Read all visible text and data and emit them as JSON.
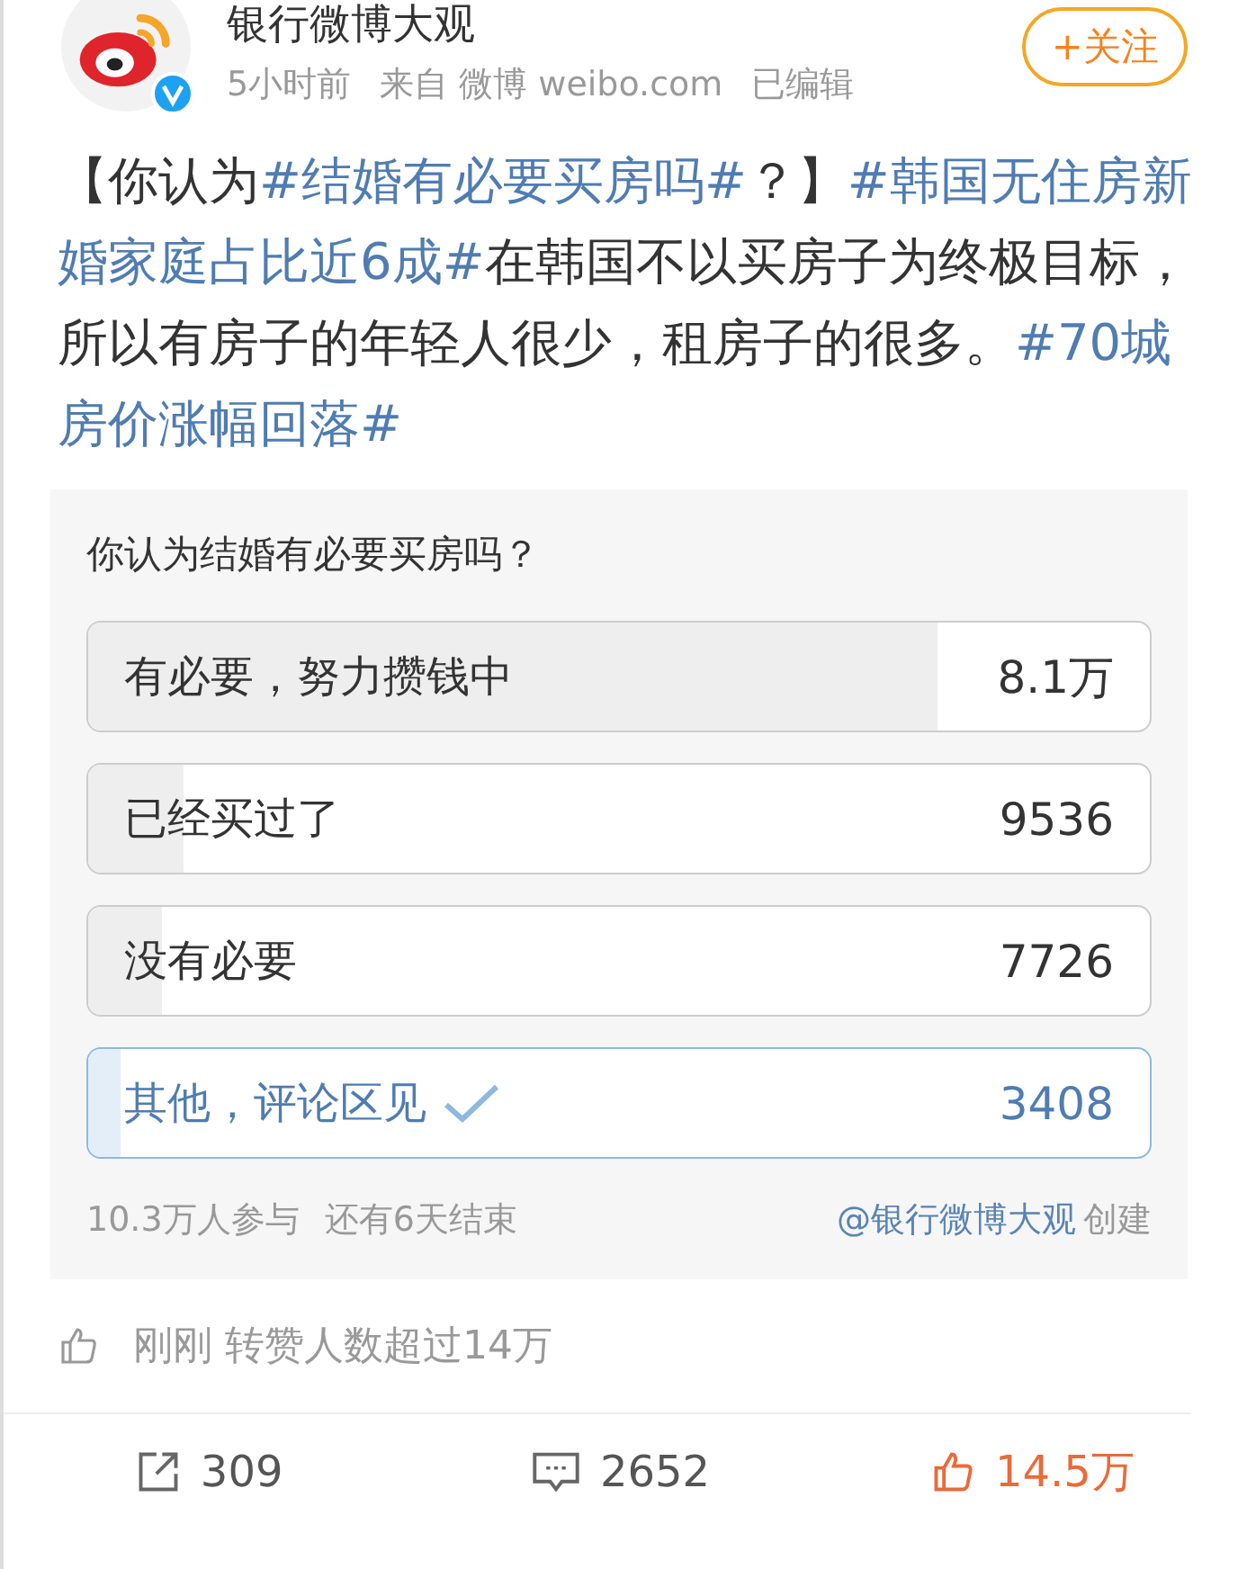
{
  "author": {
    "name": "银行微博大观",
    "meta": [
      "5小时前",
      "来自 微博 weibo.com",
      "已编辑"
    ],
    "verified": true
  },
  "follow_button": "+关注",
  "body": [
    {
      "kind": "text",
      "text": "【你认为"
    },
    {
      "kind": "tag",
      "text": "#结婚有必要买房吗#"
    },
    {
      "kind": "text",
      "text": "？】"
    },
    {
      "kind": "tag",
      "text": "#韩国无住房新婚家庭占比近6成#"
    },
    {
      "kind": "text",
      "text": "在韩国不以买房子为终极目标，所以有房子的年轻人很少，租房子的很多。"
    },
    {
      "kind": "tag",
      "text": "#70城房价涨幅回落#"
    }
  ],
  "poll": {
    "question": "你认为结婚有必要买房吗？",
    "options": [
      {
        "label": "有必要，努力攒钱中",
        "count": "8.1万",
        "level": 0.8,
        "selected": false
      },
      {
        "label": "已经买过了",
        "count": "9536",
        "level": 0.09,
        "selected": false
      },
      {
        "label": "没有必要",
        "count": "7726",
        "level": 0.07,
        "selected": false
      },
      {
        "label": "其他，评论区见",
        "count": "3408",
        "level": 0.03,
        "selected": true
      }
    ],
    "participants": "10.3万人参与",
    "remaining": "还有6天结束",
    "creator_link": "@银行微博大观",
    "creator_suffix": "创建"
  },
  "notice": "刚刚 转赞人数超过14万",
  "actions": [
    {
      "kind": "repost",
      "count": "309"
    },
    {
      "kind": "comment",
      "count": "2652"
    },
    {
      "kind": "like",
      "count": "14.5万"
    }
  ]
}
